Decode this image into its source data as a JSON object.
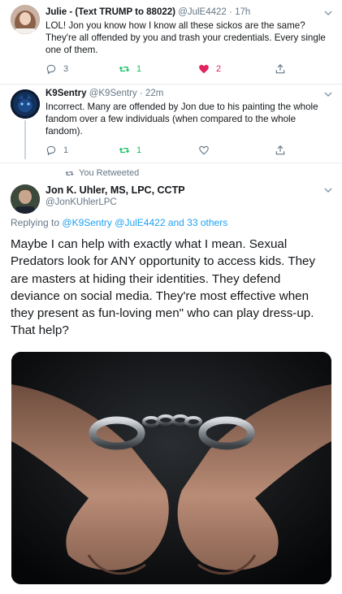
{
  "tweet1": {
    "name": "Julie - (Text TRUMP to 88022)",
    "handle": "@JulE4422",
    "dot": "·",
    "time": "17h",
    "text": "LOL! Jon you know how I know all these sickos are the same? They're all offended by you and trash your credentials. Every single one of them.",
    "replies": "3",
    "retweets": "1",
    "likes": "2"
  },
  "tweet2": {
    "name": "K9Sentry",
    "handle": "@K9Sentry",
    "dot": "·",
    "time": "22m",
    "text": "Incorrect. Many are offended by Jon due to his painting the whole fandom over a few individuals (when compared to the whole fandom).",
    "replies": "1",
    "retweets": "1"
  },
  "retweet_note": "You Retweeted",
  "main": {
    "name": "Jon K. Uhler, MS, LPC, CCTP",
    "handle": "@JonKUhlerLPC",
    "replying_prefix": "Replying to",
    "replying_to": "@K9Sentry @JulE4422 and 33 others",
    "text": "Maybe I can help with exactly what I mean. Sexual Predators look for ANY opportunity to access kids. They are masters at hiding their identities. They defend deviance on social media. They're most effective when they present as fun-loving men\" who can play dress-up. That help?"
  },
  "colors": {
    "link": "#1da1f2",
    "retweet": "#17bf63",
    "like": "#e0245e",
    "muted": "#657786"
  }
}
